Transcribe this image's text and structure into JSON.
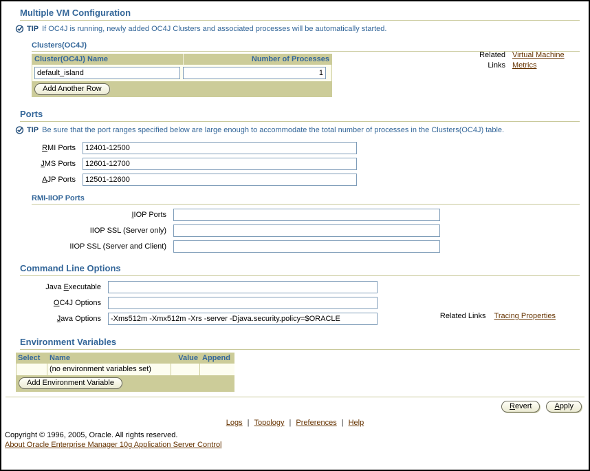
{
  "colors": {
    "heading_blue": "#336699",
    "khaki_header": "#cccc99",
    "ivory_row": "#fdfdf0",
    "link_brown": "#663300",
    "input_border": "#7f9db9"
  },
  "page": {
    "title": "Multiple VM Configuration",
    "tip_label": "TIP",
    "tip_text": "If OC4J is running, newly added OC4J Clusters and associated processes will be automatically started."
  },
  "clusters": {
    "heading": "Clusters(OC4J)",
    "columns": {
      "name": "Cluster(OC4J) Name",
      "processes": "Number of Processes"
    },
    "rows": [
      {
        "name": "default_island",
        "processes": "1"
      }
    ],
    "add_row_button": "Add Another Row",
    "related_links_label": "Related Links",
    "link_vm_metrics": "Virtual Machine Metrics"
  },
  "ports": {
    "heading": "Ports",
    "tip_label": "TIP",
    "tip_text": "Be sure that the port ranges specified below are large enough to accommodate the total number of processes in the Clusters(OC4J) table.",
    "fields": [
      {
        "label": "RMI Ports",
        "value": "12401-12500"
      },
      {
        "label": "JMS Ports",
        "value": "12601-12700"
      },
      {
        "label": "AJP Ports",
        "value": "12501-12600"
      }
    ],
    "rmi_iiop": {
      "heading": "RMI-IIOP Ports",
      "fields": [
        {
          "label": "IIOP Ports",
          "value": ""
        },
        {
          "label": "IIOP SSL (Server only)",
          "value": ""
        },
        {
          "label": "IIOP SSL (Server and Client)",
          "value": ""
        }
      ]
    }
  },
  "command_line": {
    "heading": "Command Line Options",
    "fields": [
      {
        "label": "Java Executable",
        "value": ""
      },
      {
        "label": "OC4J Options",
        "value": ""
      },
      {
        "label": "Java Options",
        "value": "-Xms512m -Xmx512m -Xrs -server -Djava.security.policy=$ORACLE"
      }
    ],
    "related_links_label": "Related Links",
    "link_tracing": "Tracing Properties"
  },
  "environment": {
    "heading": "Environment Variables",
    "columns": {
      "select": "Select",
      "name": "Name",
      "value": "Value",
      "append": "Append"
    },
    "empty_text": "(no environment variables set)",
    "add_button": "Add Environment Variable"
  },
  "actions": {
    "revert": "Revert",
    "apply": "Apply"
  },
  "footer": {
    "separator": "|",
    "links": [
      "Logs",
      "Topology",
      "Preferences",
      "Help"
    ],
    "copyright": "Copyright © 1996, 2005, Oracle. All rights reserved.",
    "about_link": "About Oracle Enterprise Manager 10g Application Server Control"
  }
}
